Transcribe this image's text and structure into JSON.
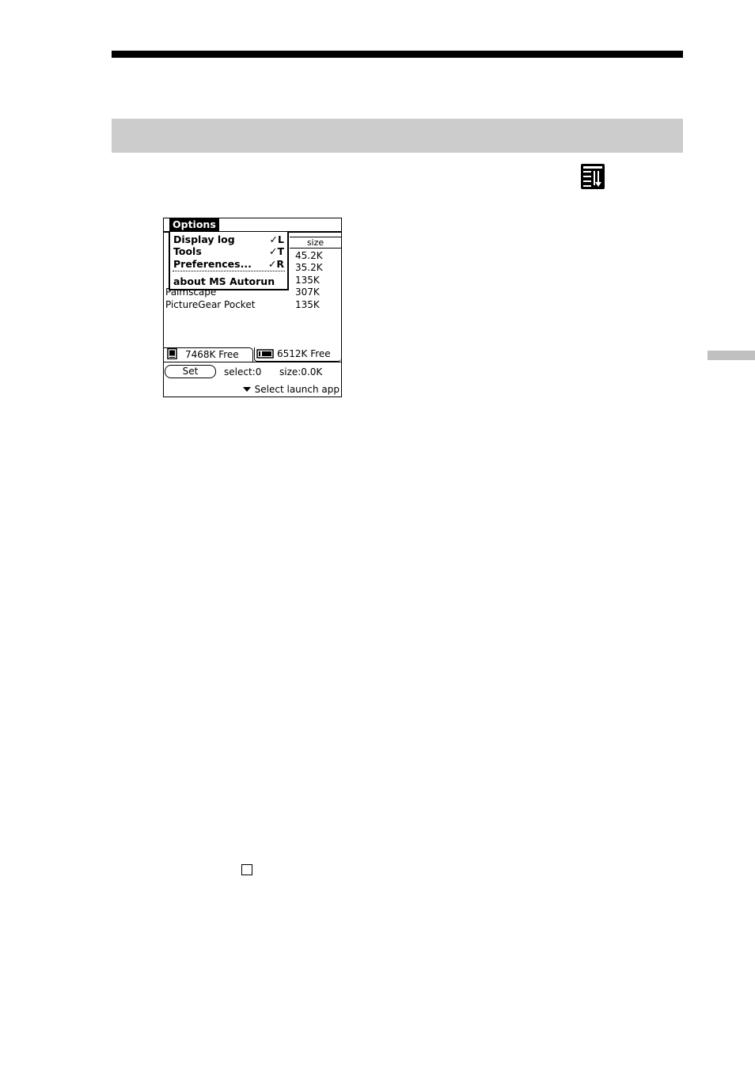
{
  "palm_screen": {
    "menu_title": "Options",
    "menu_items": [
      {
        "label": "Display log",
        "shortcut": "✓L"
      },
      {
        "label": "Tools",
        "shortcut": "✓T"
      },
      {
        "label": "Preferences...",
        "shortcut": "✓R"
      },
      {
        "label": "about MS Autorun",
        "shortcut": ""
      }
    ],
    "size_header": "size",
    "rows": [
      {
        "name": "",
        "size": "45.2K"
      },
      {
        "name": "",
        "size": "35.2K"
      },
      {
        "name": "",
        "size": "135K"
      },
      {
        "name": "Palmscape",
        "size": "307K"
      },
      {
        "name": "PictureGear Pocket",
        "size": "135K"
      }
    ],
    "internal_free": "7468K Free",
    "card_free": "6512K Free",
    "set_label": "Set",
    "select_status": "select:0",
    "size_status": "size:0.0K",
    "launch_label": "Select launch app"
  }
}
